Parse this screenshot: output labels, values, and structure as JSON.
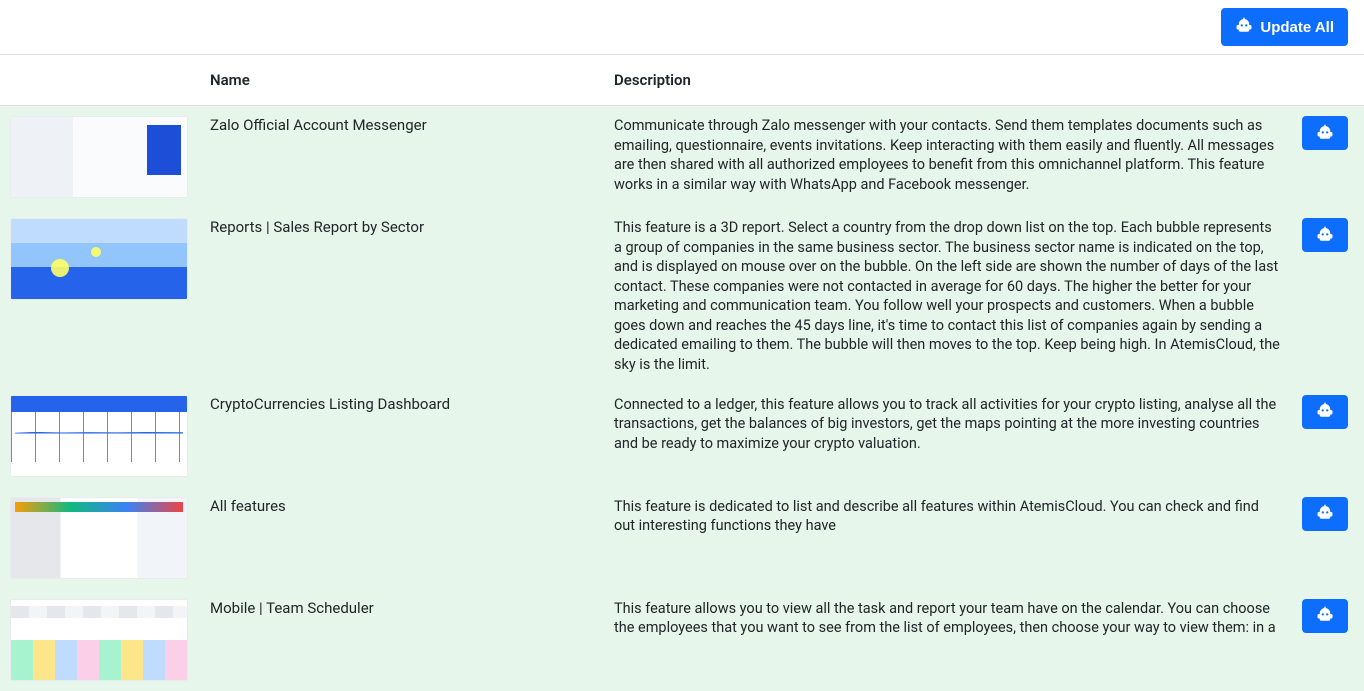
{
  "header": {
    "update_all_label": "Update All"
  },
  "columns": {
    "name": "Name",
    "description": "Description"
  },
  "rows": [
    {
      "name": "Zalo Official Account Messenger",
      "description": "Communicate through Zalo messenger with your contacts. Send them templates documents such as emailing, questionnaire, events invitations. Keep interacting with them easily and fluently. All messages are then shared with all authorized employees to benefit from this omnichannel platform. This feature works in a similar way with WhatsApp and Facebook messenger."
    },
    {
      "name": "Reports | Sales Report by Sector",
      "description": "This feature is a 3D report. Select a country from the drop down list on the top. Each bubble represents a group of companies in the same business sector. The business sector name is indicated on the top, and is displayed on mouse over on the bubble. On the left side are shown the number of days of the last contact. These companies were not contacted in average for 60 days. The higher the better for your marketing and communication team. You follow well your prospects and customers. When a bubble goes down and reaches the 45 days line, it's time to contact this list of companies again by sending a dedicated emailing to them. The bubble will then moves to the top. Keep being high. In AtemisCloud, the sky is the limit."
    },
    {
      "name": "CryptoCurrencies Listing Dashboard",
      "description": "Connected to a ledger, this feature allows you to track all activities for your crypto listing, analyse all the transactions, get the balances of big investors, get the maps pointing at the more investing countries and be ready to maximize your crypto valuation."
    },
    {
      "name": "All features",
      "description": "This feature is dedicated to list and describe all features within AtemisCloud.  You can check and find out interesting functions they have"
    },
    {
      "name": "Mobile | Team Scheduler",
      "description": "This feature allows you to view all the task and report your team have on the calendar. You can choose the employees that you want to see from the list of employees, then choose your way to view them: in a"
    }
  ]
}
